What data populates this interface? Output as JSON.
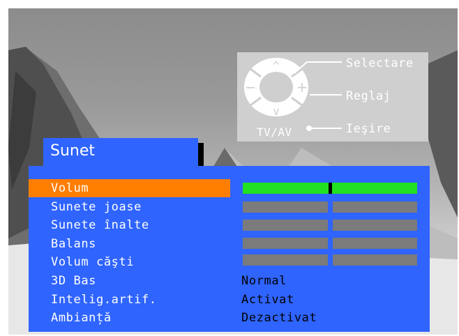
{
  "legend": {
    "select": "Selectare",
    "adjust": "Reglaj",
    "exit": "Ieşire",
    "source_button": "TV/AV"
  },
  "remote_symbols": {
    "up": "^",
    "down": "v",
    "minus": "−",
    "plus": "+"
  },
  "menu": {
    "title": "Sunet",
    "items": [
      {
        "label": "Volum",
        "type": "slider",
        "level": 0.5,
        "selected": true
      },
      {
        "label": "Sunete joase",
        "type": "slider"
      },
      {
        "label": "Sunete înalte",
        "type": "slider"
      },
      {
        "label": "Balans",
        "type": "slider"
      },
      {
        "label": "Volum căşti",
        "type": "slider"
      },
      {
        "label": "3D Bas",
        "type": "option",
        "value": "Normal"
      },
      {
        "label": "Intelig.artif.",
        "type": "option",
        "value": "Activat"
      },
      {
        "label": "Ambianță",
        "type": "option",
        "value": "Dezactivat"
      }
    ]
  },
  "colors": {
    "menu_background": "#2f64ff",
    "selected_row": "#ff7e00",
    "active_slider": "#22e022",
    "inactive_slider": "#7b7b7b",
    "panel_background": "#cfcfcf"
  }
}
